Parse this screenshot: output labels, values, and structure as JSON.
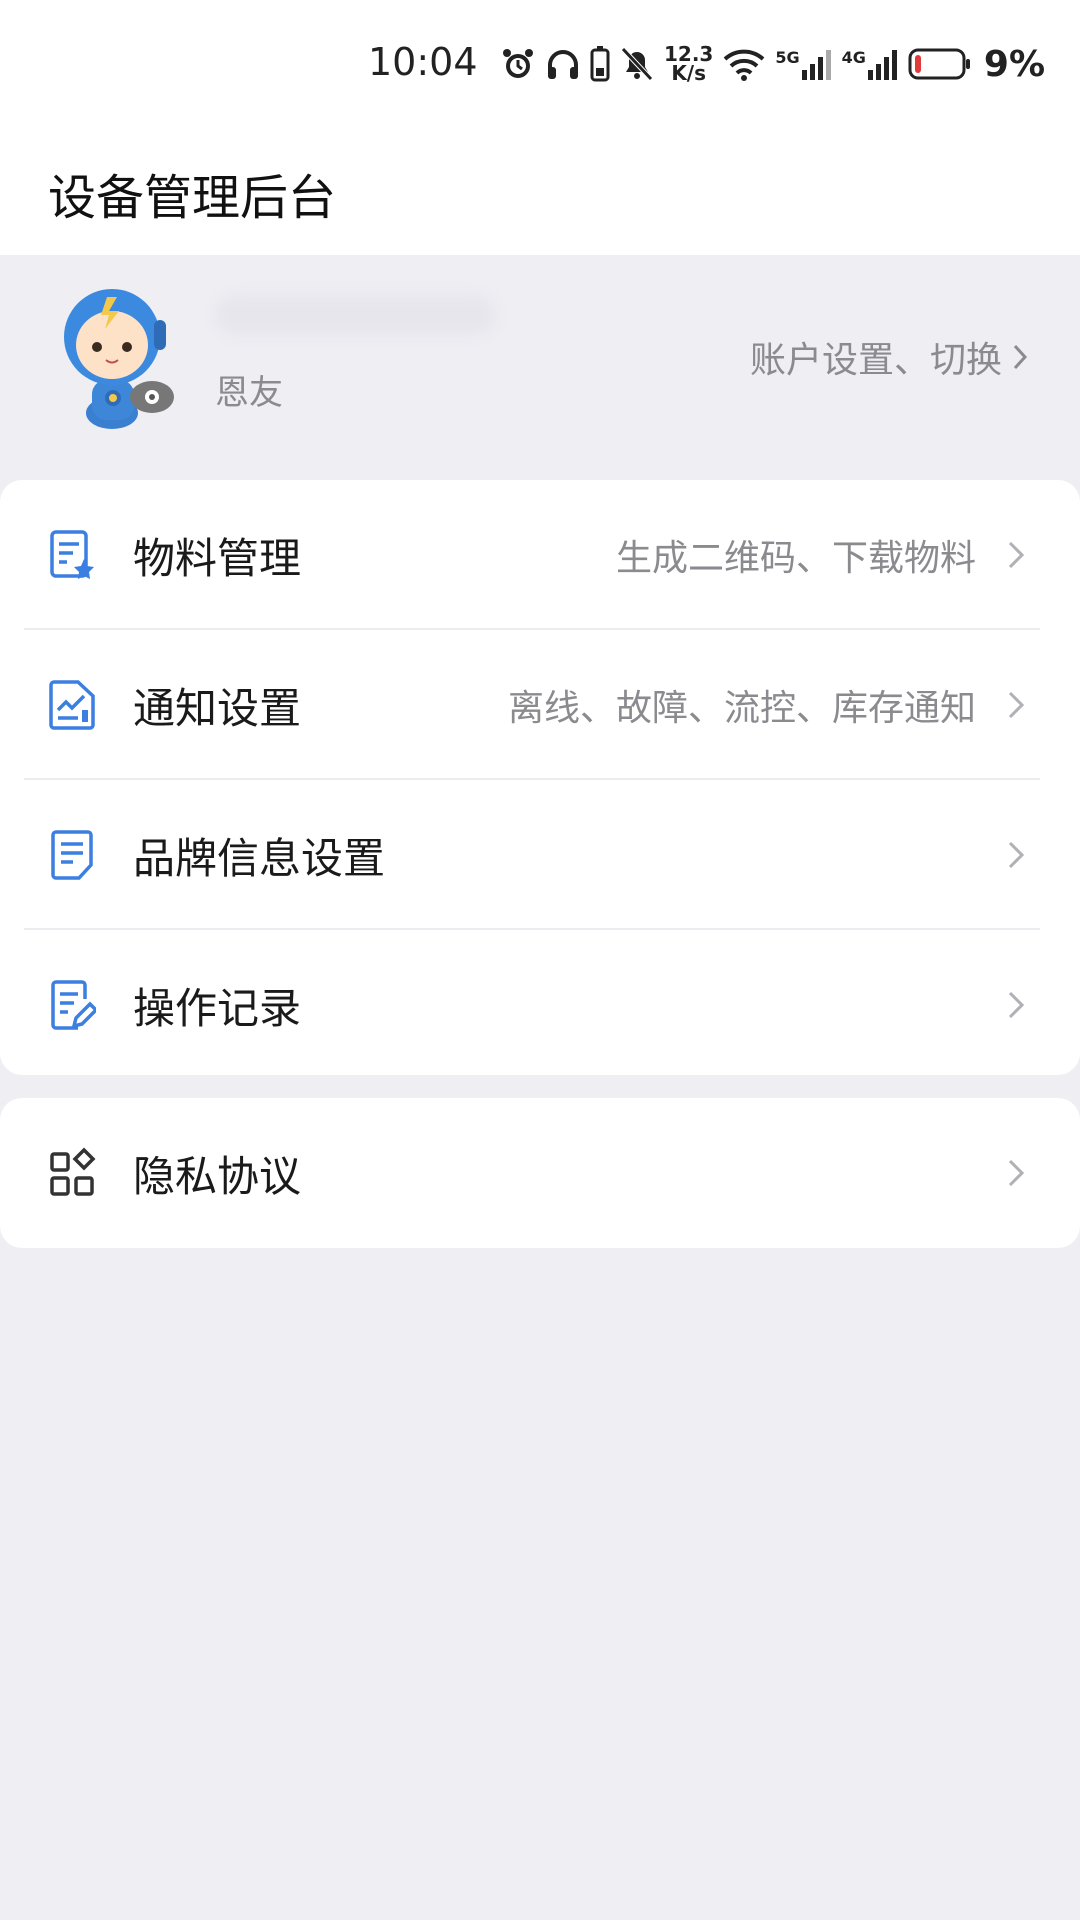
{
  "status_bar": {
    "time": "10:04",
    "net_speed": "12.3",
    "net_unit": "K/s",
    "net_5g": "5G",
    "net_4g": "4G",
    "battery": "9%",
    "icons": [
      "alarm-icon",
      "headphones-icon",
      "phone-battery-icon",
      "mute-bell-icon",
      "wifi-icon",
      "signal-5g-icon",
      "signal-4g-icon",
      "battery-icon"
    ]
  },
  "header": {
    "title": "设备管理后台"
  },
  "account": {
    "subtitle": "恩友",
    "link": "账户设置、切换"
  },
  "menu": [
    {
      "label": "物料管理",
      "hint": "生成二维码、下载物料",
      "icon": "materials-icon"
    },
    {
      "label": "通知设置",
      "hint": "离线、故障、流控、库存通知",
      "icon": "notification-chart-icon"
    },
    {
      "label": "品牌信息设置",
      "hint": "",
      "icon": "document-icon"
    },
    {
      "label": "操作记录",
      "hint": "",
      "icon": "edit-record-icon"
    }
  ],
  "menu2": [
    {
      "label": "隐私协议",
      "hint": "",
      "icon": "apps-grid-icon"
    }
  ],
  "colors": {
    "accent": "#3b7fe0",
    "background": "#eeeef3",
    "secondary_text": "#8a8a8f"
  }
}
